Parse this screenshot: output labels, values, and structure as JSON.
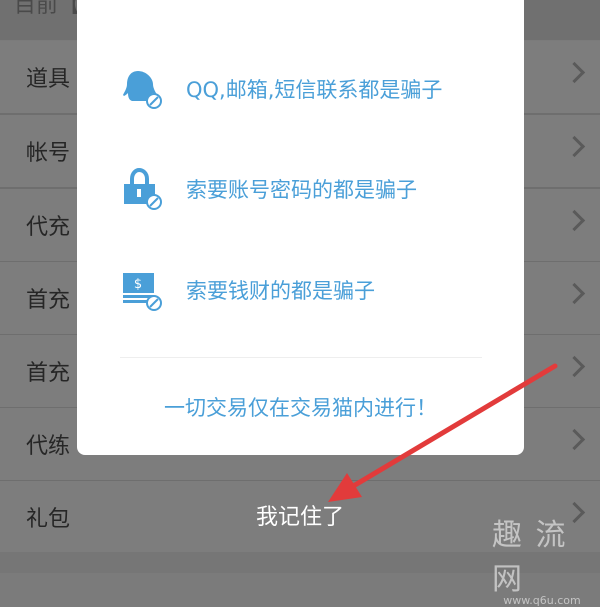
{
  "background": {
    "top_text": "目前【",
    "rows": [
      {
        "label": "道具"
      },
      {
        "label": "帐号"
      },
      {
        "label": "代充"
      },
      {
        "label": "首充"
      },
      {
        "label": "首充"
      },
      {
        "label": "代练"
      },
      {
        "label": "礼包"
      }
    ]
  },
  "dialog": {
    "rules": [
      {
        "icon": "qq-user-icon",
        "text": "QQ,邮箱,短信联系都是骗子"
      },
      {
        "icon": "lock-icon",
        "text": "索要账号密码的都是骗子"
      },
      {
        "icon": "money-icon",
        "text": "索要钱财的都是骗子"
      }
    ],
    "footer_note": "一切交易仅在交易猫内进行！"
  },
  "confirm_label": "我记住了",
  "watermark": {
    "big": "趣 流 网",
    "small": "www.q6u.com"
  },
  "colors": {
    "accent": "#4a9fd8",
    "overlay": "#7b7b7b",
    "arrow": "#e23b3b"
  }
}
